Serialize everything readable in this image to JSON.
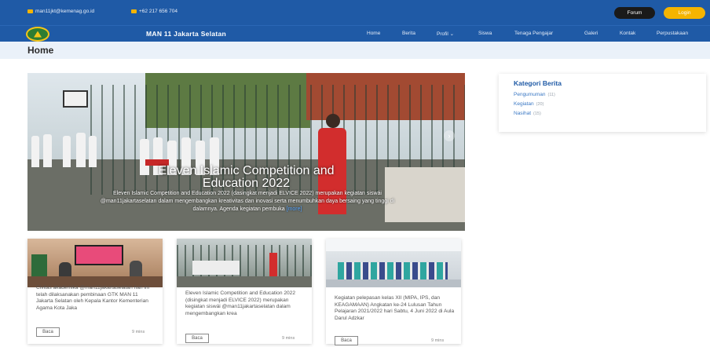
{
  "topbar": {
    "email": "man11jkt@kemenag.go.id",
    "phone": "+62 217 656 704",
    "forum_label": "Forum",
    "login_label": "Login"
  },
  "navbar": {
    "brand": "MAN 11 Jakarta Selatan",
    "menu": [
      "Home",
      "Berita",
      "Profil ⌄",
      "Siswa",
      "Tenaga Pengajar",
      "Galeri",
      "Kontak",
      "Perpustakaan"
    ]
  },
  "page": {
    "title": "Home"
  },
  "slider": {
    "title_line1": "Eleven Islamic Competition and",
    "title_line2": "Education 2022",
    "desc": "Eleven Islamic Competition and Education 2022 (dasingkat menjadi ELVICE 2022) merupakan kegiatan siswái @man11jakartaselatan dalam mengembangkan kreativitas dan inovasi serta menumbuhkan daya bersaing yang tinggi di dalamnya. Agenda kegiatan pembuka",
    "link": "[more]",
    "next_icon": "chevron-right-icon"
  },
  "sidebar": {
    "title": "Kategori Berita",
    "items": [
      {
        "label": "Pengumuman",
        "count": "(11)"
      },
      {
        "label": "Kegiatan",
        "count": "(20)"
      },
      {
        "label": "Nasihat",
        "count": "(15)"
      }
    ]
  },
  "cards": [
    {
      "text": "Civitas akademika @man11jakartaselatan hari ini telah dilaksanakan pembinaan GTK MAN 11 Jakarta Selatan oleh Kepala Kantor Kementerian Agama Kota Jaka",
      "read": "Baca",
      "mins": "9 mins"
    },
    {
      "text": "Eleven Islamic Competition and Education 2022 (disingkat menjadi ELVICE 2022) merupakan kegiatan siswái @man11jakartaselatan dalam mengembangkan krea",
      "read": "Baca",
      "mins": "9 mins"
    },
    {
      "text": "Kegiatan pelepasan kelas XII (MIPA, IPS, dan KEAGAMAAN) Angkatan ke-24 Lulusan Tahun Pelajaran 2021/2022 hari Sabtu, 4 Juni 2022 di Aula Darul Adzkar",
      "read": "Baca",
      "mins": "9 mins"
    }
  ],
  "colors": {
    "primary": "#1f5aa6",
    "accent": "#f5b400",
    "breadcrumb": "#eaf1f9"
  }
}
